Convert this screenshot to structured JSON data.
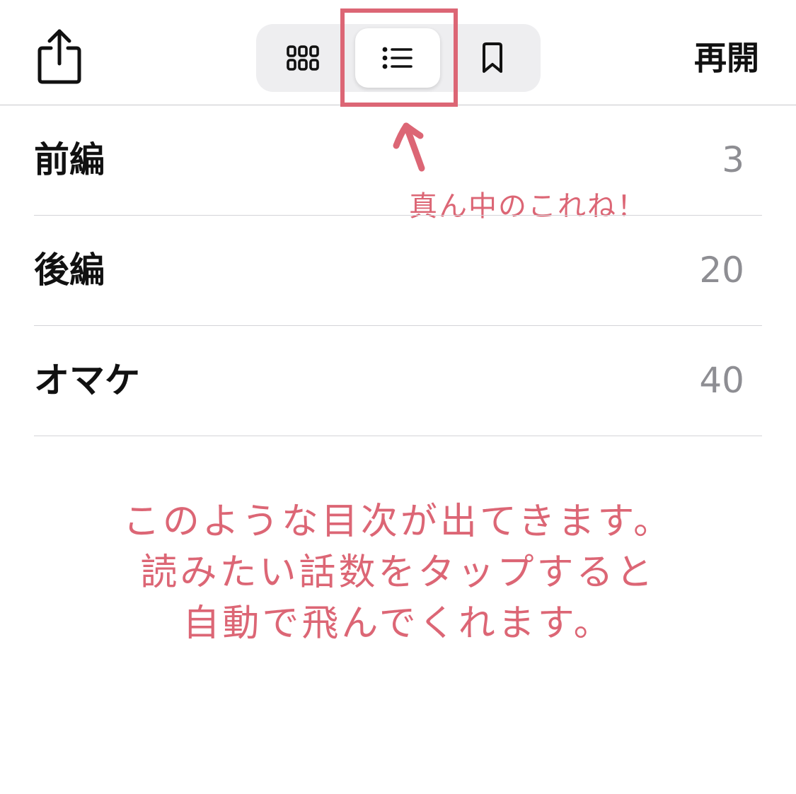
{
  "toolbar": {
    "share_icon": "share-icon",
    "segments": [
      {
        "icon": "grid-icon",
        "selected": false
      },
      {
        "icon": "list-icon",
        "selected": true
      },
      {
        "icon": "bookmark-icon",
        "selected": false
      }
    ],
    "resume_label": "再開"
  },
  "toc": {
    "items": [
      {
        "title": "前編",
        "count": "3"
      },
      {
        "title": "後編",
        "count": "20"
      },
      {
        "title": "オマケ",
        "count": "40"
      }
    ]
  },
  "annotations": {
    "pointer_note": "真ん中のこれね！",
    "explanation": [
      "このような目次が出てきます。",
      "読みたい話数をタップすると",
      "自動で飛んでくれます。"
    ]
  },
  "colors": {
    "annotation": "#dc6675",
    "count_text": "#8e8e93",
    "segment_bg": "#eeeef0"
  }
}
